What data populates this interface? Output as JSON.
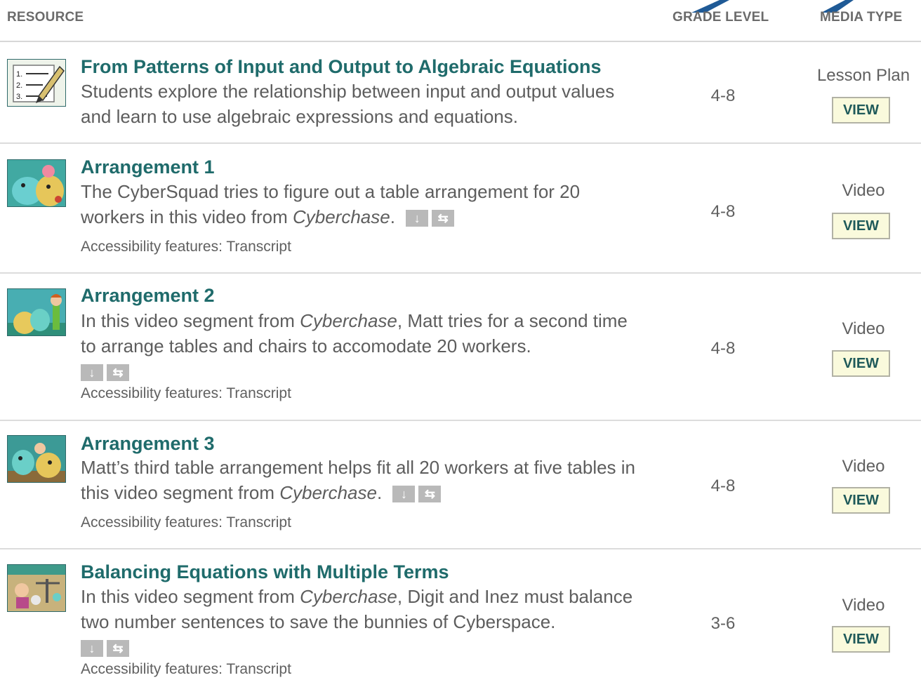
{
  "header": {
    "resource": "RESOURCE",
    "grade_level": "GRADE LEVEL",
    "media_type": "MEDIA TYPE"
  },
  "colors": {
    "title": "#1f6b6b",
    "text": "#5d5d5d",
    "view_bg": "#fafadc",
    "arrow": "#1f5a96"
  },
  "rows": [
    {
      "title": "From Patterns of Input and Output to Algebraic Equations",
      "desc_a": "Students explore the relationship between input and output values and learn to use algebraic expressions and equations.",
      "grade": "4-8",
      "media": "Lesson Plan",
      "view": "VIEW",
      "thumb_icon": "lesson-plan-list-icon"
    },
    {
      "title": "Arrangement 1",
      "desc_a": "The CyberSquad tries to figure out a table arrangement for 20 workers in this video from ",
      "desc_em": "Cyberchase",
      "desc_b": ".",
      "accessibility": "Accessibility features: Transcript",
      "grade": "4-8",
      "media": "Video",
      "view": "VIEW",
      "icon_download": "↓",
      "icon_share": "⇆"
    },
    {
      "title": "Arrangement 2",
      "desc_a": "In this video segment from ",
      "desc_em": "Cyberchase",
      "desc_b": ", Matt tries for a second time to arrange tables and chairs to accomodate 20 workers.",
      "accessibility": "Accessibility features: Transcript",
      "grade": "4-8",
      "media": "Video",
      "view": "VIEW",
      "icon_download": "↓",
      "icon_share": "⇆"
    },
    {
      "title": "Arrangement 3",
      "desc_a": "Matt’s third table arrangement helps fit all 20 workers at five tables in this video segment from ",
      "desc_em": "Cyberchase",
      "desc_b": ".",
      "accessibility": "Accessibility features: Transcript",
      "grade": "4-8",
      "media": "Video",
      "view": "VIEW",
      "icon_download": "↓",
      "icon_share": "⇆"
    },
    {
      "title": "Balancing Equations with Multiple Terms",
      "desc_a": "In this video segment from ",
      "desc_em": "Cyberchase",
      "desc_b": ", Digit and Inez must balance two number sentences to save the bunnies of Cyberspace.",
      "accessibility": "Accessibility features: Transcript",
      "grade": "3-6",
      "media": "Video",
      "view": "VIEW",
      "icon_download": "↓",
      "icon_share": "⇆"
    }
  ]
}
